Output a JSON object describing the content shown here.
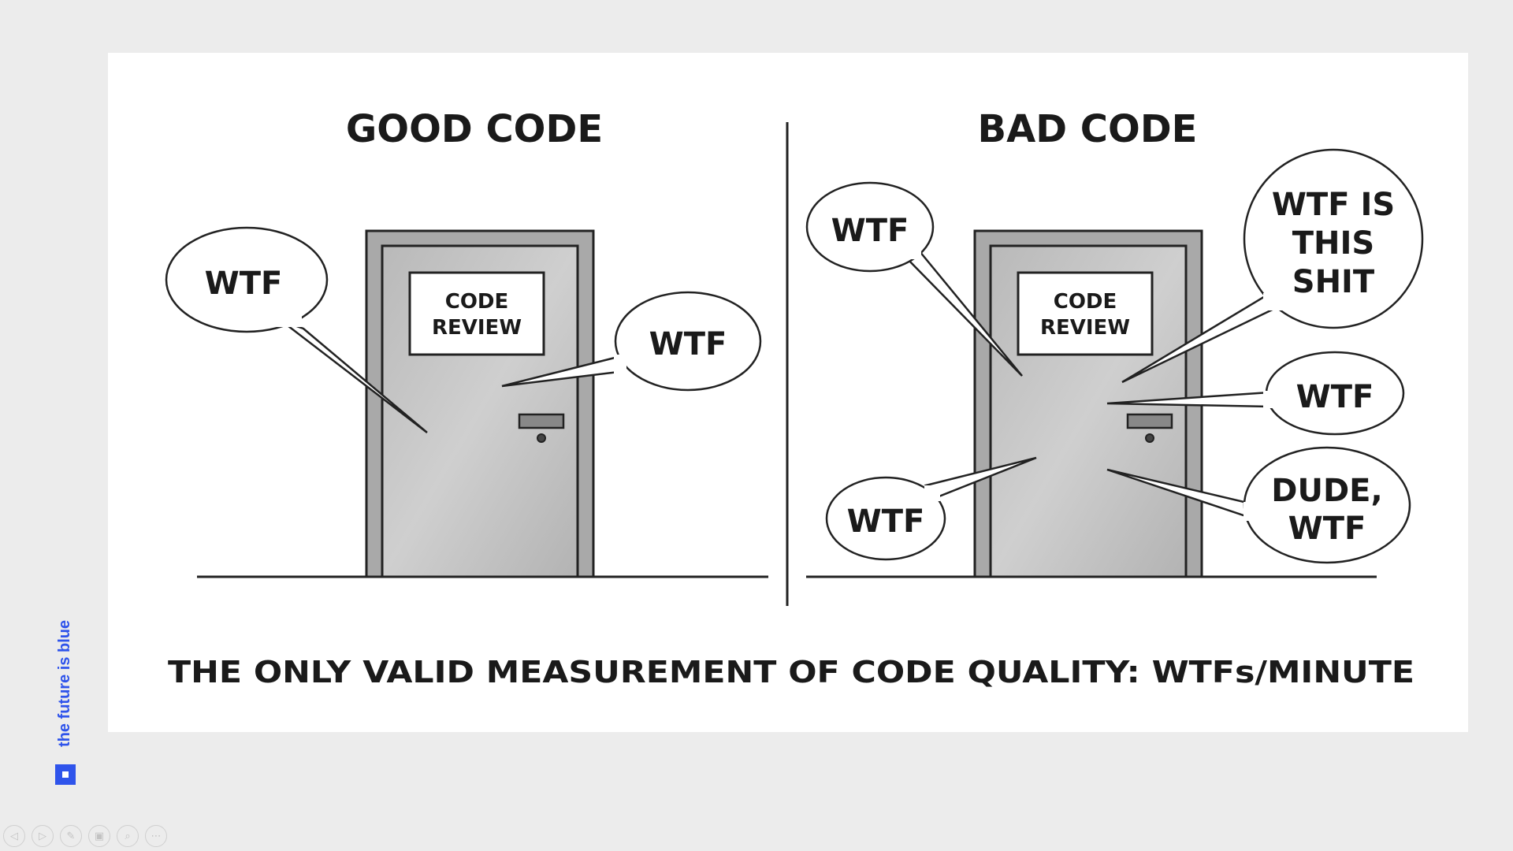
{
  "slide": {
    "left_title": "GOOD CODE",
    "right_title": "BAD CODE",
    "door_sign_line1": "CODE",
    "door_sign_line2": "REVIEW",
    "bubbles_left": [
      "WTF",
      "WTF"
    ],
    "bubbles_right": {
      "top_left": "WTF",
      "top_right_line1": "WTF IS",
      "top_right_line2": "THIS",
      "top_right_line3": "SHIT",
      "mid_right": "WTF",
      "bottom_left": "WTF",
      "bottom_right_line1": "DUDE,",
      "bottom_right_line2": "WTF"
    },
    "caption": "THE ONLY VALID MEASUREMENT OF CODE QUALITY: WTFs/MINUTE"
  },
  "brand": {
    "label": "the future is blue",
    "accent_color": "#2f54eb"
  },
  "toolbar": {
    "buttons": [
      {
        "icon": "previous-icon",
        "glyph": "◁"
      },
      {
        "icon": "next-icon",
        "glyph": "▷"
      },
      {
        "icon": "pen-icon",
        "glyph": "✎"
      },
      {
        "icon": "slides-icon",
        "glyph": "▣"
      },
      {
        "icon": "zoom-icon",
        "glyph": "⌕"
      },
      {
        "icon": "more-icon",
        "glyph": "⋯"
      }
    ]
  }
}
